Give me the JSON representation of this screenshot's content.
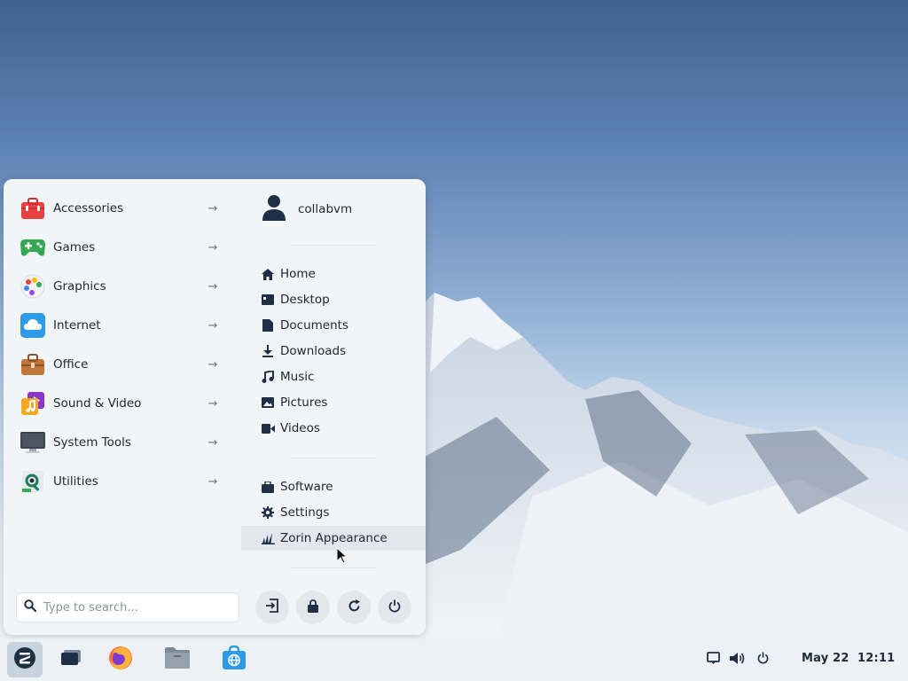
{
  "menu": {
    "categories": [
      {
        "label": "Accessories"
      },
      {
        "label": "Games"
      },
      {
        "label": "Graphics"
      },
      {
        "label": "Internet"
      },
      {
        "label": "Office"
      },
      {
        "label": "Sound & Video"
      },
      {
        "label": "System Tools"
      },
      {
        "label": "Utilities"
      }
    ],
    "user": {
      "name": "collabvm"
    },
    "places": [
      {
        "label": "Home",
        "icon": "home-icon"
      },
      {
        "label": "Desktop",
        "icon": "desktop-icon"
      },
      {
        "label": "Documents",
        "icon": "document-icon"
      },
      {
        "label": "Downloads",
        "icon": "download-icon"
      },
      {
        "label": "Music",
        "icon": "music-icon"
      },
      {
        "label": "Pictures",
        "icon": "picture-icon"
      },
      {
        "label": "Videos",
        "icon": "video-icon"
      }
    ],
    "system": [
      {
        "label": "Software",
        "icon": "software-bag-icon"
      },
      {
        "label": "Settings",
        "icon": "gear-icon"
      },
      {
        "label": "Zorin Appearance",
        "icon": "appearance-icon"
      }
    ],
    "search": {
      "placeholder": "Type to search..."
    },
    "session_buttons": [
      "logout-icon",
      "lock-icon",
      "restart-icon",
      "power-icon"
    ]
  },
  "taskbar": {
    "apps": [
      "zorin-menu-icon",
      "workspaces-icon",
      "firefox-icon",
      "files-icon",
      "software-store-icon"
    ],
    "tray": [
      "notification-icon",
      "volume-icon",
      "power-icon"
    ],
    "clock": "May 22  12:11"
  },
  "colors": {
    "menu_bg": "#f2f5f8",
    "accent": "#2e9be6",
    "icon_dark": "#1f2f45"
  }
}
